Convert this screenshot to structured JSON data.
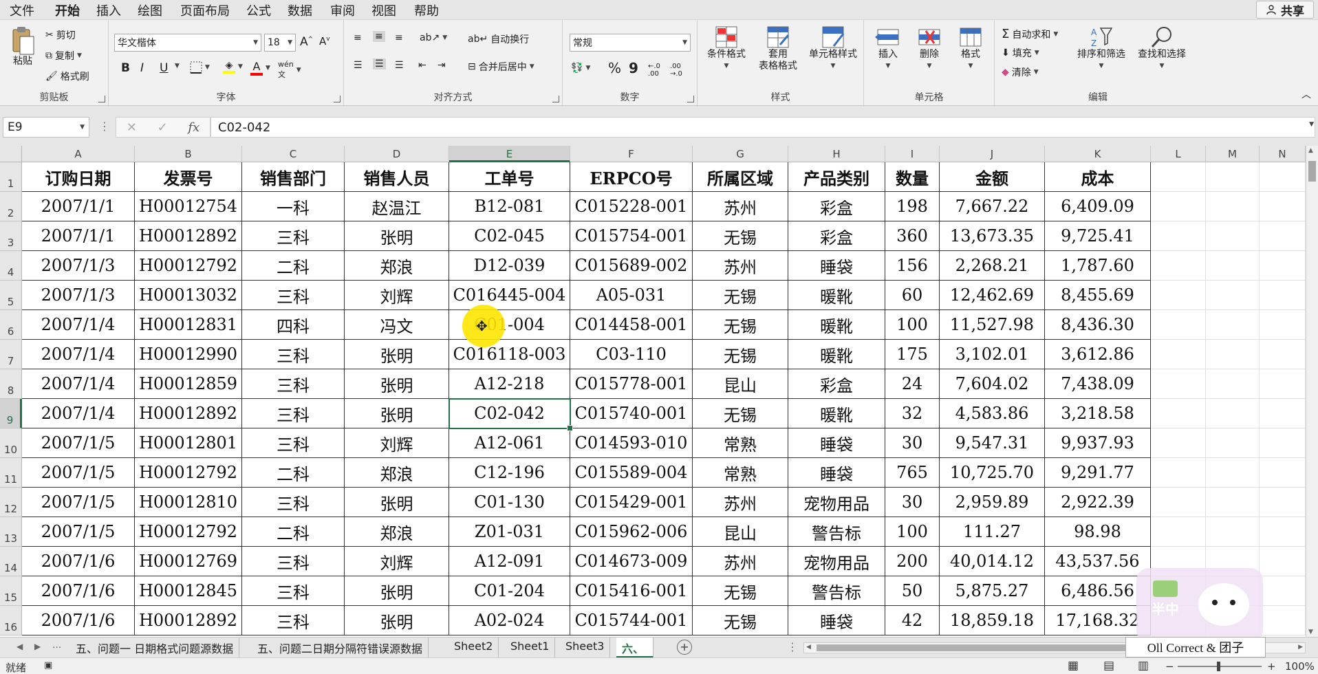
{
  "menu": {
    "items": [
      "文件",
      "开始",
      "插入",
      "绘图",
      "页面布局",
      "公式",
      "数据",
      "审阅",
      "视图",
      "帮助"
    ],
    "active": "开始",
    "share": "共享"
  },
  "ribbon": {
    "clipboard": {
      "paste": "粘贴",
      "cut": "剪切",
      "copy": "复制",
      "format_painter": "格式刷",
      "label": "剪贴板"
    },
    "font": {
      "name": "华文楷体",
      "size": "18",
      "bold": "B",
      "italic": "I",
      "underline": "U",
      "label": "字体",
      "font_color": "#ff0000",
      "highlight_color": "#ffff00"
    },
    "alignment": {
      "wrap_text": "自动换行",
      "merge_center": "合并后居中",
      "label": "对齐方式"
    },
    "number": {
      "format": "常规",
      "percent": "%",
      "comma": "9",
      "label": "数字"
    },
    "styles": {
      "conditional": "条件格式",
      "table_format": "套用\n表格格式",
      "cell_styles": "单元格样式",
      "label": "样式"
    },
    "cells": {
      "insert": "插入",
      "delete": "删除",
      "format": "格式",
      "label": "单元格"
    },
    "editing": {
      "autosum": "自动求和",
      "fill": "填充",
      "clear": "清除",
      "sort_filter": "排序和筛选",
      "find_select": "查找和选择",
      "label": "编辑"
    }
  },
  "formula_bar": {
    "name_box": "E9",
    "fx": "fx",
    "formula": "C02-042"
  },
  "columns": [
    "A",
    "B",
    "C",
    "D",
    "E",
    "F",
    "G",
    "H",
    "I",
    "J",
    "K",
    "L",
    "M",
    "N"
  ],
  "selected": {
    "column": "E",
    "row": 9
  },
  "header_row": [
    "订购日期",
    "发票号",
    "销售部门",
    "销售人员",
    "工单号",
    "ERPCO号",
    "所属区域",
    "产品类别",
    "数量",
    "金额",
    "成本"
  ],
  "rows": [
    [
      "2007/1/1",
      "H00012754",
      "一科",
      "赵温江",
      "B12-081",
      "C015228-001",
      "苏州",
      "彩盒",
      "198",
      "7,667.22",
      "6,409.09"
    ],
    [
      "2007/1/1",
      "H00012892",
      "三科",
      "张明",
      "C02-045",
      "C015754-001",
      "无锡",
      "彩盒",
      "360",
      "13,673.35",
      "9,725.41"
    ],
    [
      "2007/1/3",
      "H00012792",
      "二科",
      "郑浪",
      "D12-039",
      "C015689-002",
      "苏州",
      "睡袋",
      "156",
      "2,268.21",
      "1,787.60"
    ],
    [
      "2007/1/3",
      "H00013032",
      "三科",
      "刘辉",
      "C016445-004",
      "A05-031",
      "无锡",
      "暖靴",
      "60",
      "12,462.69",
      "8,455.69"
    ],
    [
      "2007/1/4",
      "H00012831",
      "四科",
      "冯文",
      "C01-004",
      "C014458-001",
      "无锡",
      "暖靴",
      "100",
      "11,527.98",
      "8,436.30"
    ],
    [
      "2007/1/4",
      "H00012990",
      "三科",
      "张明",
      "C016118-003",
      "C03-110",
      "无锡",
      "暖靴",
      "175",
      "3,102.01",
      "3,612.86"
    ],
    [
      "2007/1/4",
      "H00012859",
      "三科",
      "张明",
      "A12-218",
      "C015778-001",
      "昆山",
      "彩盒",
      "24",
      "7,604.02",
      "7,438.09"
    ],
    [
      "2007/1/4",
      "H00012892",
      "三科",
      "张明",
      "C02-042",
      "C015740-001",
      "无锡",
      "暖靴",
      "32",
      "4,583.86",
      "3,218.58"
    ],
    [
      "2007/1/5",
      "H00012801",
      "三科",
      "刘辉",
      "A12-061",
      "C014593-010",
      "常熟",
      "睡袋",
      "30",
      "9,547.31",
      "9,937.93"
    ],
    [
      "2007/1/5",
      "H00012792",
      "二科",
      "郑浪",
      "C12-196",
      "C015589-004",
      "常熟",
      "睡袋",
      "765",
      "10,725.70",
      "9,291.77"
    ],
    [
      "2007/1/5",
      "H00012810",
      "三科",
      "张明",
      "C01-130",
      "C015429-001",
      "苏州",
      "宠物用品",
      "30",
      "2,959.89",
      "2,922.39"
    ],
    [
      "2007/1/5",
      "H00012792",
      "二科",
      "郑浪",
      "Z01-031",
      "C015962-006",
      "昆山",
      "警告标",
      "100",
      "111.27",
      "98.98"
    ],
    [
      "2007/1/6",
      "H00012769",
      "三科",
      "刘辉",
      "A12-091",
      "C014673-009",
      "苏州",
      "宠物用品",
      "200",
      "40,014.12",
      "43,537.56"
    ],
    [
      "2007/1/6",
      "H00012845",
      "三科",
      "张明",
      "C01-204",
      "C015416-001",
      "无锡",
      "警告标",
      "50",
      "5,875.27",
      "6,486.56"
    ],
    [
      "2007/1/6",
      "H00012892",
      "三科",
      "张明",
      "A02-024",
      "C015744-001",
      "无锡",
      "睡袋",
      "42",
      "18,859.18",
      "17,168.32"
    ]
  ],
  "sheet_tabs": {
    "items": [
      "五、问题一 日期格式问题源数据",
      "五、问题二日期分隔符错误源数据",
      "Sheet2",
      "Sheet1",
      "Sheet3",
      "六、"
    ],
    "active": "六、",
    "ellipsis": "..."
  },
  "status": {
    "ready": "就绪",
    "zoom": "100%"
  },
  "watermark": {
    "text": "Oll Correct & 团子",
    "mascot_label": "半中"
  },
  "colors": {
    "accent": "#217346",
    "cursor_highlight": "#ffe600"
  }
}
